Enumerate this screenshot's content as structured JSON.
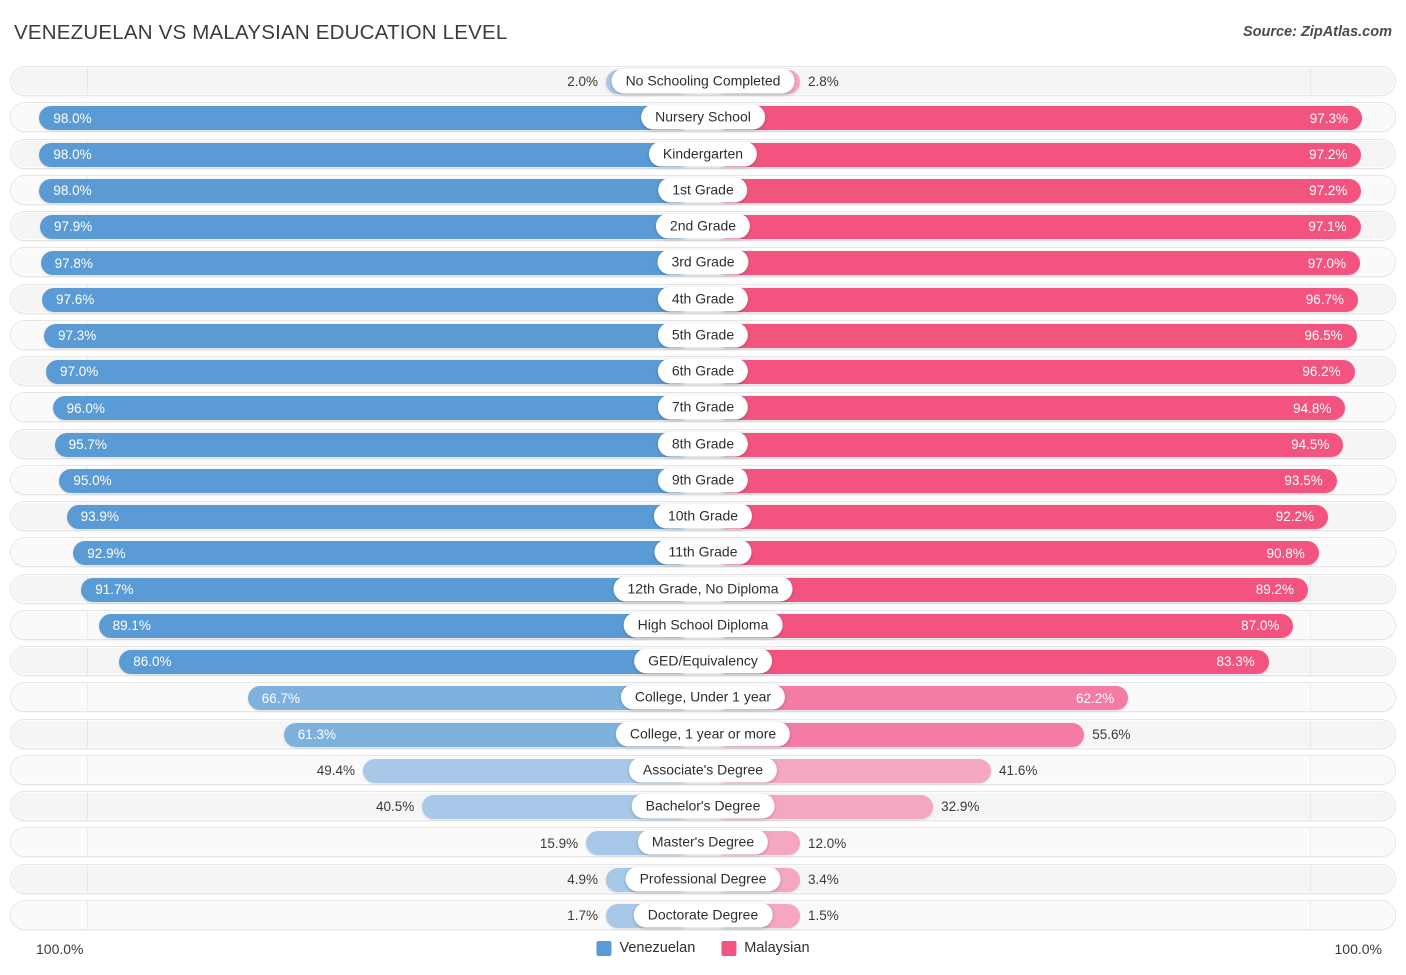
{
  "header": {
    "title": "Venezuelan vs Malaysian Education Level",
    "source": "Source: ZipAtlas.com"
  },
  "legend": {
    "items": [
      {
        "label": "Venezuelan",
        "color": "#5b9bd5"
      },
      {
        "label": "Malaysian",
        "color": "#f2547f"
      }
    ]
  },
  "axis": {
    "left": "100.0%",
    "right": "100.0%"
  },
  "colors": {
    "blue_strong": "#5b9bd5",
    "blue_mid": "#7fb1de",
    "blue_light": "#a7c8e8",
    "pink_strong": "#f2547f",
    "pink_mid": "#f47ba1",
    "pink_light": "#f4a7c2",
    "row_bg": "#f7f7f7",
    "row_border": "#e6e6e6"
  },
  "chart_data": {
    "type": "bar",
    "title": "Venezuelan vs Malaysian Education Level",
    "orientation": "horizontal-diverging",
    "xlabel": "",
    "ylabel": "",
    "xlim": [
      0,
      100
    ],
    "grid": false,
    "legend_position": "bottom-center",
    "categories": [
      "No Schooling Completed",
      "Nursery School",
      "Kindergarten",
      "1st Grade",
      "2nd Grade",
      "3rd Grade",
      "4th Grade",
      "5th Grade",
      "6th Grade",
      "7th Grade",
      "8th Grade",
      "9th Grade",
      "10th Grade",
      "11th Grade",
      "12th Grade, No Diploma",
      "High School Diploma",
      "GED/Equivalency",
      "College, Under 1 year",
      "College, 1 year or more",
      "Associate's Degree",
      "Bachelor's Degree",
      "Master's Degree",
      "Professional Degree",
      "Doctorate Degree"
    ],
    "series": [
      {
        "name": "Venezuelan",
        "color": "#5b9bd5",
        "values": [
          2.0,
          98.0,
          98.0,
          98.0,
          97.9,
          97.8,
          97.6,
          97.3,
          97.0,
          96.0,
          95.7,
          95.0,
          93.9,
          92.9,
          91.7,
          89.1,
          86.0,
          66.7,
          61.3,
          49.4,
          40.5,
          15.9,
          4.9,
          1.7
        ],
        "labels": [
          "2.0%",
          "98.0%",
          "98.0%",
          "98.0%",
          "97.9%",
          "97.8%",
          "97.6%",
          "97.3%",
          "97.0%",
          "96.0%",
          "95.7%",
          "95.0%",
          "93.9%",
          "92.9%",
          "91.7%",
          "89.1%",
          "86.0%",
          "66.7%",
          "61.3%",
          "49.4%",
          "40.5%",
          "15.9%",
          "4.9%",
          "1.7%"
        ]
      },
      {
        "name": "Malaysian",
        "color": "#f2547f",
        "values": [
          2.8,
          97.3,
          97.2,
          97.2,
          97.1,
          97.0,
          96.7,
          96.5,
          96.2,
          94.8,
          94.5,
          93.5,
          92.2,
          90.8,
          89.2,
          87.0,
          83.3,
          62.2,
          55.6,
          41.6,
          32.9,
          12.0,
          3.4,
          1.5
        ],
        "labels": [
          "2.8%",
          "97.3%",
          "97.2%",
          "97.2%",
          "97.1%",
          "97.0%",
          "96.7%",
          "96.5%",
          "96.2%",
          "94.8%",
          "94.5%",
          "93.5%",
          "92.2%",
          "90.8%",
          "89.2%",
          "87.0%",
          "83.3%",
          "62.2%",
          "55.6%",
          "41.6%",
          "32.9%",
          "12.0%",
          "3.4%",
          "1.5%"
        ]
      }
    ]
  }
}
